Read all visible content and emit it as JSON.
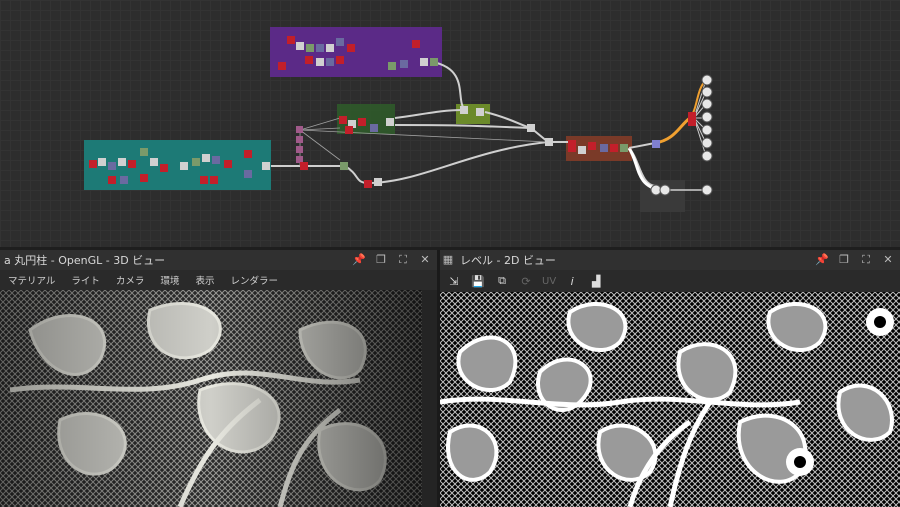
{
  "panel3d": {
    "title": "a 丸円柱 - OpenGL - 3D ビュー",
    "menu": [
      "マテリアル",
      "ライト",
      "カメラ",
      "環境",
      "表示",
      "レンダラー"
    ]
  },
  "panel2d": {
    "title": "レベル - 2D ビュー",
    "uv_label": "UV"
  },
  "colors": {
    "frame_purple": "#6b2fa0",
    "frame_teal": "#1f8a86",
    "frame_green": "#6b8a2a",
    "frame_brown": "#8a3a2a",
    "node_red": "#c21f2a",
    "node_gray": "#d0d0d0",
    "wire_orange": "#f0a030"
  }
}
